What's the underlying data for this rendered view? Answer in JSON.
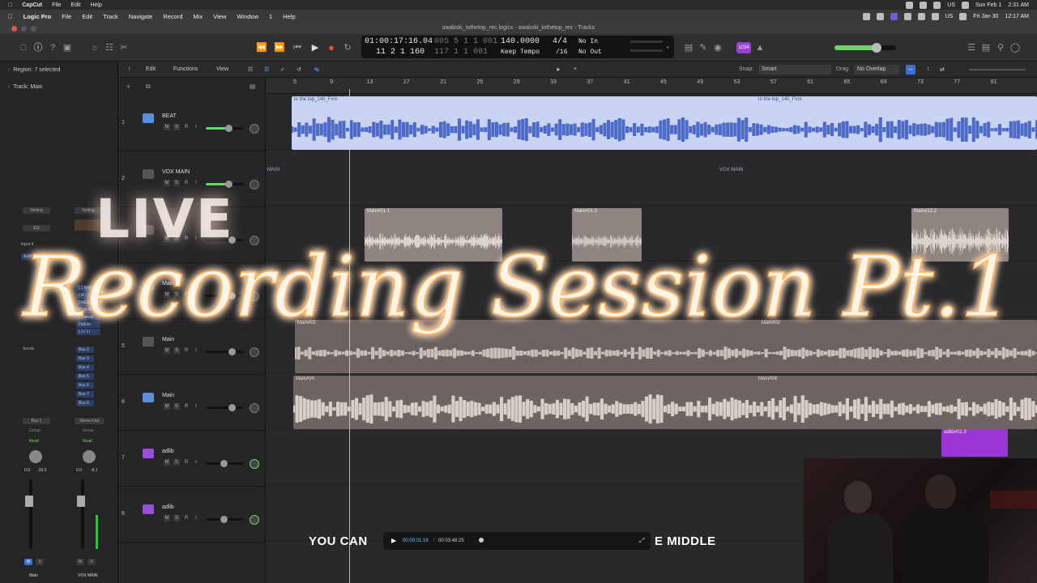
{
  "menubar_top": {
    "app": "CapCut",
    "items": [
      "File",
      "Edit",
      "Help"
    ],
    "status_right": [
      "US",
      "Sun Feb 1",
      "2:31 AM"
    ]
  },
  "menubar": {
    "app": "Logic Pro",
    "items": [
      "File",
      "Edit",
      "Track",
      "Navigate",
      "Record",
      "Mix",
      "View",
      "Window",
      "1",
      "Help"
    ],
    "status_right": [
      "US",
      "Fri Jan 30",
      "12:17 AM"
    ]
  },
  "window": {
    "title": "swabski_tothetop_rec.logicx - swabski_tothetop_rec - Tracks",
    "tab": "swabski_tothetop_rec.logicx"
  },
  "lcd": {
    "timecode": "01:00:17:16.04",
    "timecode_sub": "005 5 1 1 001",
    "bars": "11 2 1 160",
    "bars_sub": "117 1 1 001",
    "tempo": "140.0000",
    "tempo_label": "Keep Tempo",
    "signature": "4/4",
    "division": "/16",
    "in": "No In",
    "out": "No Out"
  },
  "toolbar": {
    "key_badge": "1234"
  },
  "track_bar": {
    "edit": "Edit",
    "functions": "Functions",
    "view": "View",
    "snap_label": "Snap:",
    "snap_value": "Smart",
    "drag_label": "Drag:",
    "drag_value": "No Overlap"
  },
  "inspector": {
    "region_label": "Region:",
    "region_value": "7 selected",
    "track_label": "Track:",
    "track_value": "Main",
    "setting": "Setting",
    "eq": "EQ",
    "input": "Input 4",
    "autotune": "Auto-Tune",
    "plugins": [
      "L1 limiter",
      "C4",
      "DeEss",
      "CLA-76",
      "Channel",
      "DeEss",
      "L1+ Li"
    ],
    "sends": "Sends",
    "buses": [
      "Bus 2",
      "Bus 3",
      "Bus 4",
      "Bus 5",
      "Bus 6",
      "Bus 7",
      "Bus 8"
    ],
    "out_left": "Bus 1",
    "out_right": "Stereo Out",
    "group": "Group",
    "read": "Read",
    "vol_left": "0.0",
    "peak_left": "-30.0",
    "vol_right": "0.0",
    "peak_right": "-8.1",
    "strip_left": "Main",
    "strip_right": "VOX MAIN"
  },
  "ruler": [
    "5",
    "9",
    "13",
    "17",
    "21",
    "25",
    "29",
    "33",
    "37",
    "41",
    "45",
    "49",
    "53",
    "57",
    "61",
    "65",
    "69",
    "73",
    "77",
    "81"
  ],
  "tracks": [
    {
      "num": "1",
      "name": "BEAT",
      "color": "#5b8fd8"
    },
    {
      "num": "2",
      "name": "VOX MAIN",
      "color": "#555"
    },
    {
      "num": "3",
      "name": "",
      "color": "#555"
    },
    {
      "num": "4",
      "name": "Main",
      "color": "#555"
    },
    {
      "num": "5",
      "name": "Main",
      "color": "#555"
    },
    {
      "num": "6",
      "name": "Main",
      "color": "#5b8fd8"
    },
    {
      "num": "7",
      "name": "adlib",
      "color": "#9a4fd8"
    },
    {
      "num": "8",
      "name": "adlib",
      "color": "#9a4fd8"
    }
  ],
  "regions": {
    "beat_a": "to the top_140_F#m",
    "beat_b": "to the top_140_F#m",
    "vox_main_a": "MAIN",
    "vox_main_b": "VOX MAIN",
    "r3a": "Main#01.1",
    "r3b": "Main#01.3",
    "r3c": "Main#12.2",
    "r5a": "Main#02",
    "r5b": "Main#02",
    "r6a": "Main#04",
    "r6b": "Main#04",
    "adlib": "adlib#01.3"
  },
  "overlay": {
    "live": "LIVE",
    "title": "Recording Session Pt.1",
    "subtitle_left": "YOU CAN",
    "subtitle_right": "E MIDDLE",
    "player_time": "00:00:01:16",
    "player_total": "00:03:48:25"
  },
  "colors": {
    "beat_region": "#c9d3f2",
    "vox_region": "#8e8480",
    "adlib_region": "#9a35d6",
    "glow": "#ffb45a"
  }
}
